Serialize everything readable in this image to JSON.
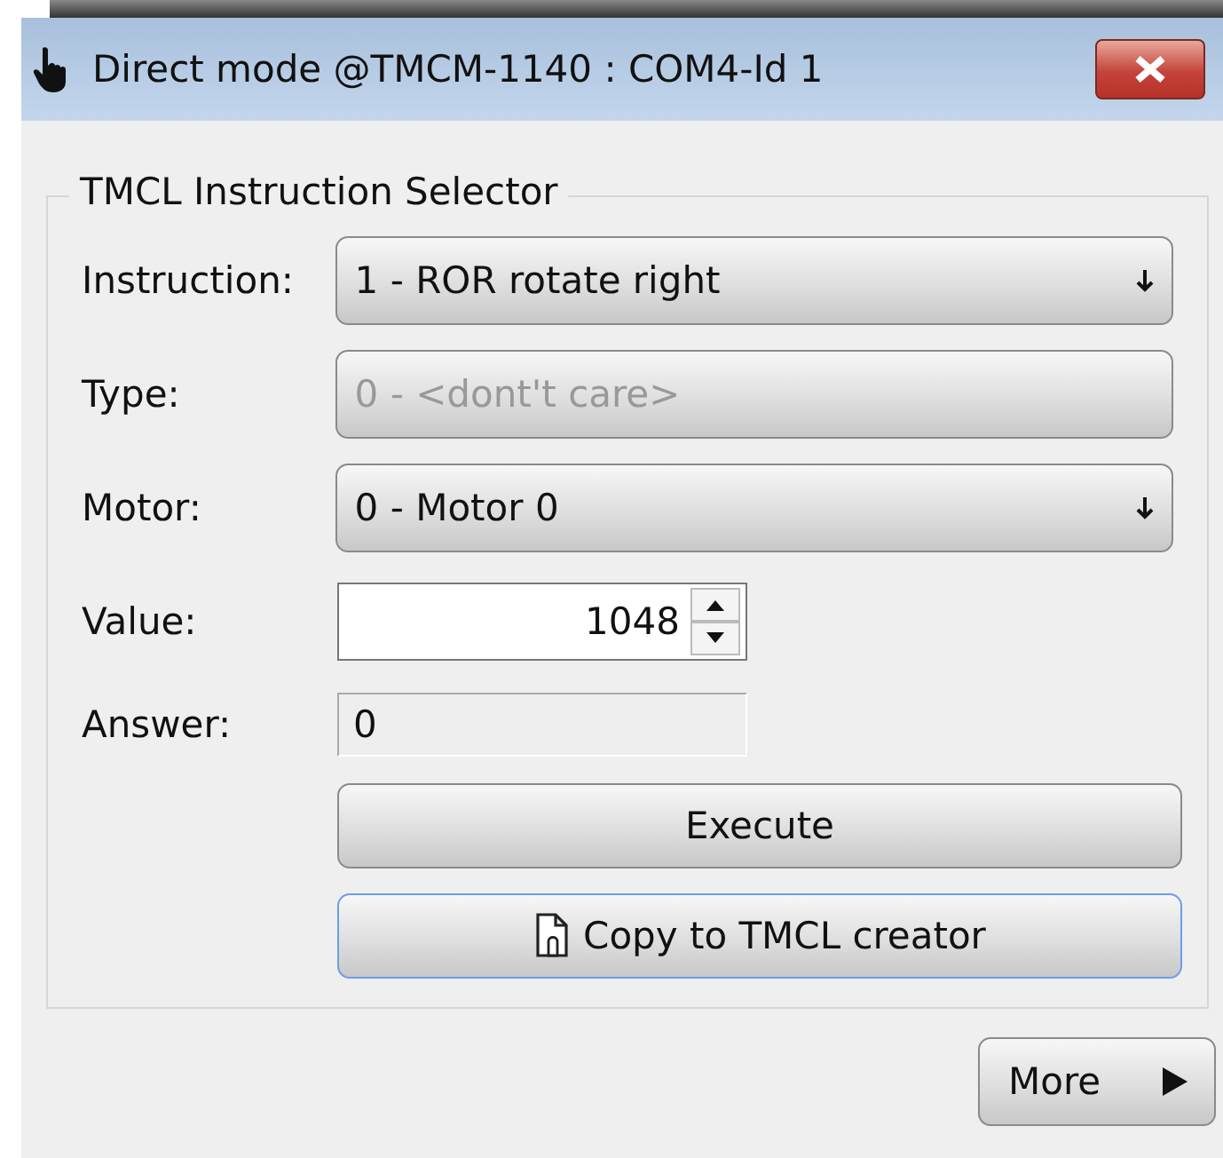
{
  "window": {
    "title": "Direct mode @TMCM-1140 : COM4-Id 1"
  },
  "group": {
    "title": "TMCL Instruction Selector"
  },
  "fields": [
    {
      "kind": "combo",
      "label": "Instruction:",
      "value": "1 - ROR rotate right",
      "disabled": false
    },
    {
      "kind": "combo",
      "label": "Type:",
      "value": "0 - <dont't care>",
      "disabled": true
    },
    {
      "kind": "combo",
      "label": "Motor:",
      "value": "0 - Motor 0",
      "disabled": false
    },
    {
      "kind": "spin",
      "label": "Value:",
      "value": "1048"
    },
    {
      "kind": "readonly",
      "label": "Answer:",
      "value": "0"
    }
  ],
  "buttons": [
    {
      "label": "Execute",
      "focused": false,
      "icon": false
    },
    {
      "label": "Copy to TMCL creator",
      "focused": true,
      "icon": true
    }
  ],
  "more_button": {
    "label": "More"
  }
}
